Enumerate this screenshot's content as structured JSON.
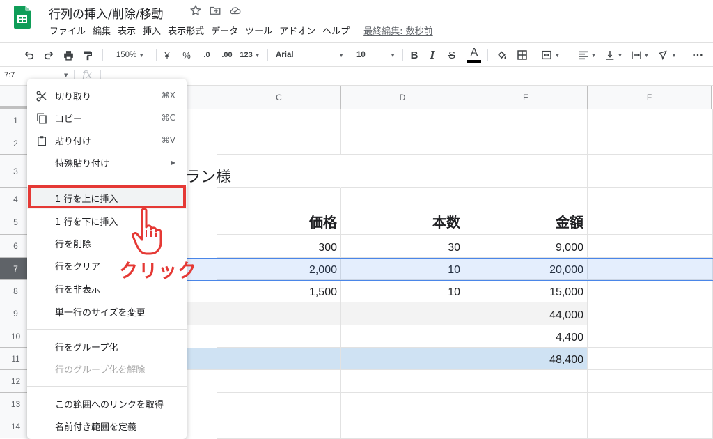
{
  "doc": {
    "title": "行列の挿入/削除/移動",
    "menu": [
      "ファイル",
      "編集",
      "表示",
      "挿入",
      "表示形式",
      "データ",
      "ツール",
      "アドオン",
      "ヘルプ"
    ],
    "last_edit": "最終編集: 数秒前"
  },
  "toolbar": {
    "zoom": "150%",
    "currency": "¥",
    "percent": "%",
    "dec_less": ".0",
    "dec_more": ".00",
    "format": "123",
    "font": "Arial",
    "font_size": "10",
    "bold": "B",
    "italic": "I",
    "strike": "S",
    "text_color": "A"
  },
  "formula_bar": {
    "name_box": "7:7",
    "fx": "fx"
  },
  "columns": [
    "C",
    "D",
    "E",
    "F"
  ],
  "rows": [
    "1",
    "2",
    "3",
    "4",
    "5",
    "6",
    "7",
    "8",
    "9",
    "10",
    "11",
    "12",
    "13",
    "14"
  ],
  "sheet": {
    "title_text": "ラン様",
    "r5": {
      "c": "価格",
      "d": "本数",
      "e": "金額"
    },
    "r6": {
      "c": "300",
      "d": "30",
      "e": "9,000"
    },
    "r7": {
      "c": "2,000",
      "d": "10",
      "e": "20,000"
    },
    "r8": {
      "c": "1,500",
      "d": "10",
      "e": "15,000"
    },
    "r9": {
      "e": "44,000"
    },
    "r10": {
      "e": "4,400"
    },
    "r11": {
      "e": "48,400"
    }
  },
  "context_menu": {
    "cut": {
      "label": "切り取り",
      "shortcut": "⌘X"
    },
    "copy": {
      "label": "コピー",
      "shortcut": "⌘C"
    },
    "paste": {
      "label": "貼り付け",
      "shortcut": "⌘V"
    },
    "paste_special": {
      "label": "特殊貼り付け"
    },
    "insert_above": {
      "label": "1 行を上に挿入"
    },
    "insert_below": {
      "label": "1 行を下に挿入"
    },
    "delete_row": {
      "label": "行を削除"
    },
    "clear_row": {
      "label": "行をクリア"
    },
    "hide_row": {
      "label": "行を非表示"
    },
    "resize_row": {
      "label": "単一行のサイズを変更"
    },
    "group_row": {
      "label": "行をグループ化"
    },
    "ungroup_row": {
      "label": "行のグループ化を解除"
    },
    "get_link": {
      "label": "この範囲へのリンクを取得"
    },
    "named_range": {
      "label": "名前付き範囲を定義"
    }
  },
  "annotation": {
    "label": "クリック",
    "color": "#e53935"
  },
  "colors": {
    "accent": "#e53935",
    "selection": "#4a86e8",
    "blue_cell": "#cfe2f3",
    "gray_cell": "#f3f3f3",
    "sheets_green": "#0f9d58"
  },
  "icons": [
    "sheets-logo-icon",
    "star-icon",
    "move-folder-icon",
    "cloud-saved-icon",
    "undo-icon",
    "redo-icon",
    "print-icon",
    "paint-format-icon",
    "fill-color-icon",
    "borders-icon",
    "merge-icon",
    "align-icon",
    "valign-icon",
    "wrap-icon",
    "rotate-icon",
    "more-icon",
    "scissors-icon",
    "copy-icon",
    "clipboard-icon",
    "pointing-hand-icon"
  ]
}
